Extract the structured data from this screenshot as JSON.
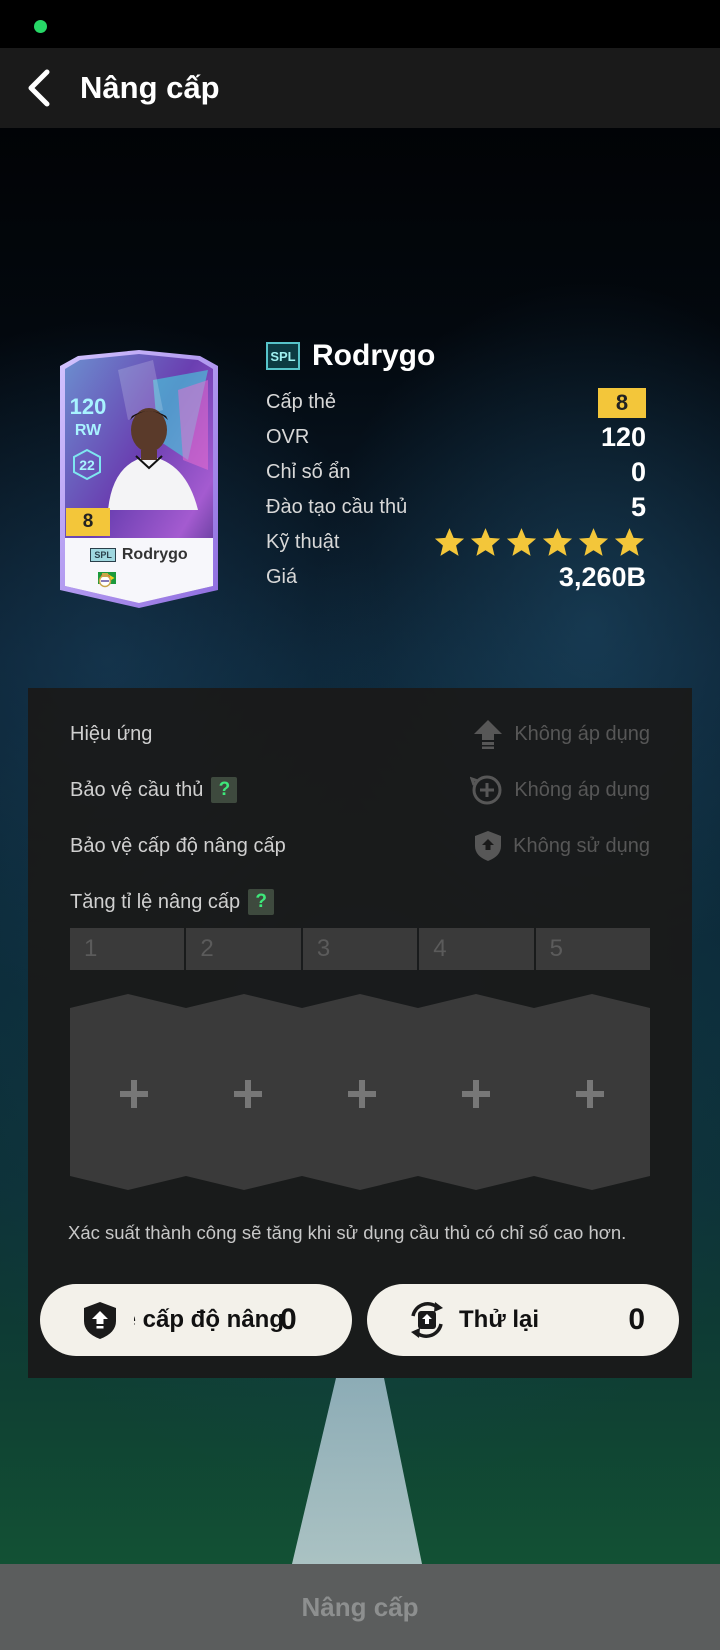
{
  "header": {
    "title": "Nâng cấp",
    "back_icon": "chevron-left-icon"
  },
  "card": {
    "ovr": "120",
    "position": "RW",
    "number": "22",
    "grade": "8",
    "season": "SPL",
    "name": "Rodrygo"
  },
  "player": {
    "season": "SPL",
    "name": "Rodrygo",
    "stats": {
      "grade_label": "Cấp thẻ",
      "grade_value": "8",
      "ovr_label": "OVR",
      "ovr_value": "120",
      "hidden_label": "Chỉ số ẩn",
      "hidden_value": "0",
      "training_label": "Đào tạo cầu thủ",
      "training_value": "5",
      "skill_label": "Kỹ thuật",
      "skill_stars": 6,
      "price_label": "Giá",
      "price_value": "3,260B"
    }
  },
  "options": {
    "effect_label": "Hiệu ứng",
    "effect_status": "Không áp dụng",
    "protect_player_label": "Bảo vệ cầu thủ",
    "protect_player_status": "Không áp dụng",
    "protect_level_label": "Bảo vệ cấp độ nâng cấp",
    "protect_level_status": "Không sử dụng",
    "boost_label": "Tăng tỉ lệ nâng cấp",
    "help_icon": "?"
  },
  "steps": [
    "1",
    "2",
    "3",
    "4",
    "5"
  ],
  "note": "Xác suất thành công sẽ tăng khi sử dụng cầu thủ có chỉ số cao hơn.",
  "buttons": {
    "protect_label": "Bảo vệ cấp độ nâng",
    "protect_count": "0",
    "retry_label": "Thử lại",
    "retry_count": "0"
  },
  "upgrade_button": "Nâng cấp",
  "colors": {
    "accent_gold": "#f3c63a",
    "help_green": "#3ee87a",
    "status_dot": "#27d867"
  }
}
